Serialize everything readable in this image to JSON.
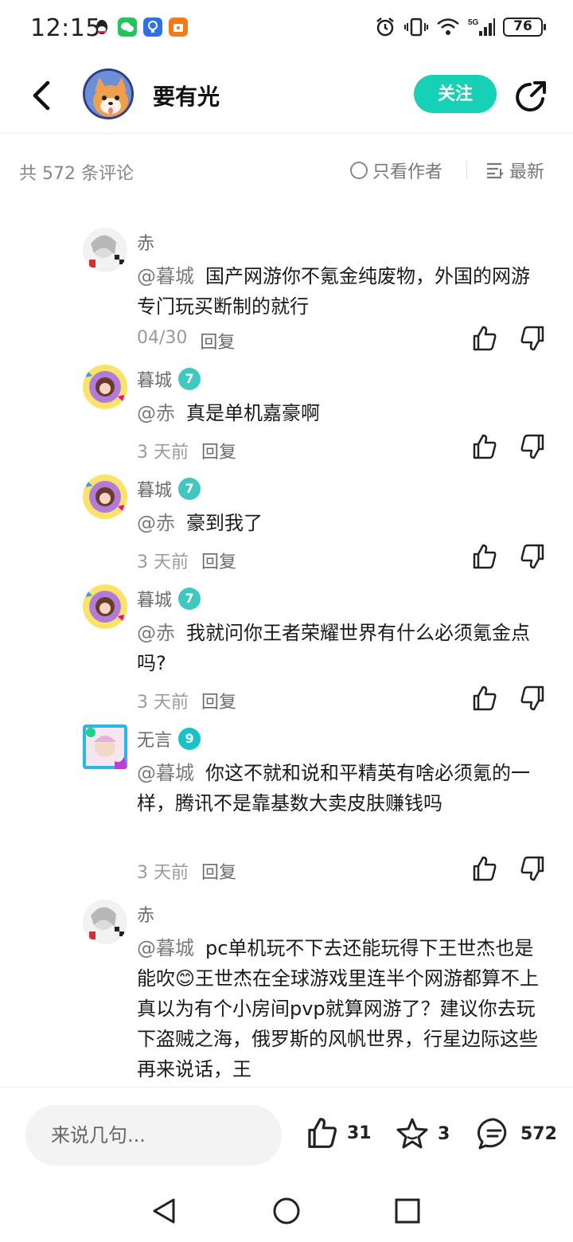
{
  "status_bar": {
    "time": "12:15",
    "network": "5G",
    "battery": "76"
  },
  "header": {
    "author_name": "要有光",
    "follow_label": "关注"
  },
  "summary": {
    "count_text": "共 572 条评论",
    "only_author_label": "只看作者",
    "sort_label": "最新"
  },
  "replies": [
    {
      "name": "赤",
      "level": "",
      "mention": "@暮城",
      "text": "国产网游你不氪金纯废物，外国的网游专门玩买断制的就行",
      "time": "04/30",
      "reply_label": "回复"
    },
    {
      "name": "暮城",
      "level": "7",
      "mention": "@赤",
      "text": "真是单机嘉豪啊",
      "time": "3 天前",
      "reply_label": "回复"
    },
    {
      "name": "暮城",
      "level": "7",
      "mention": "@赤",
      "text": "豪到我了",
      "time": "3 天前",
      "reply_label": "回复"
    },
    {
      "name": "暮城",
      "level": "7",
      "mention": "@赤",
      "text": "我就问你王者荣耀世界有什么必须氪金点吗?",
      "time": "3 天前",
      "reply_label": "回复"
    },
    {
      "name": "无言",
      "level": "9",
      "mention": "@暮城",
      "text": "你这不就和说和平精英有啥必须氪的一样，腾讯不是靠基数大卖皮肤赚钱吗",
      "time": "3 天前",
      "reply_label": "回复"
    },
    {
      "name": "赤",
      "level": "",
      "mention": "@暮城",
      "text": "pc单机玩不下去还能玩得下王世杰也是能吹😊王世杰在全球游戏里连半个网游都算不上真以为有个小房间pvp就算网游了？建议你去玩下盗贼之海，俄罗斯的风帆世界，行星边际这些再来说话，王",
      "time": "",
      "reply_label": ""
    }
  ],
  "bottom_bar": {
    "input_placeholder": "来说几句...",
    "like_count": "31",
    "favorite_count": "3",
    "comment_count": "572"
  },
  "colors": {
    "accent": "#16d1b6",
    "level_7": "#3fc7c0",
    "level_9": "#18c2c9"
  }
}
